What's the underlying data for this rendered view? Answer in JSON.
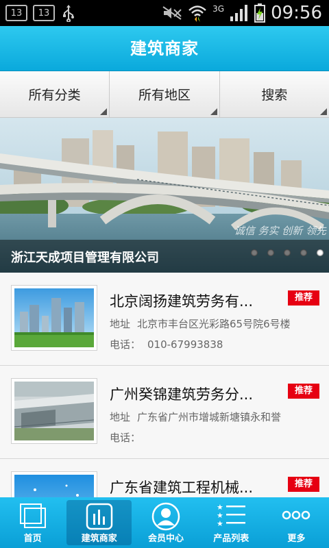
{
  "status_bar": {
    "left_badges": [
      "13",
      "13"
    ],
    "network": "3G",
    "time": "09:56"
  },
  "header": {
    "title": "建筑商家"
  },
  "filters": [
    {
      "label": "所有分类"
    },
    {
      "label": "所有地区"
    },
    {
      "label": "搜索"
    }
  ],
  "banner": {
    "caption": "浙江天成项目管理有限公司",
    "slogan": "诚信 务实 创新 领先",
    "slides": 5,
    "active_slide": 5
  },
  "businesses": [
    {
      "name": "北京阔扬建筑劳务有...",
      "badge": "推荐",
      "address_label": "地址",
      "address": "北京市丰台区光彩路65号院6号楼",
      "phone_label": "电话：",
      "phone": "010-67993838"
    },
    {
      "name": "广州癸锦建筑劳务分...",
      "badge": "推荐",
      "address_label": "地址",
      "address": "广东省广州市增城新塘镇永和誉",
      "phone_label": "电话：",
      "phone": ""
    },
    {
      "name": "广东省建筑工程机械...",
      "badge": "推荐",
      "address_label": "",
      "address": "",
      "phone_label": "",
      "phone": ""
    }
  ],
  "bottom_nav": [
    {
      "label": "首页",
      "icon": "home-icon"
    },
    {
      "label": "建筑商家",
      "icon": "chart-icon",
      "active": true
    },
    {
      "label": "会员中心",
      "icon": "user-icon"
    },
    {
      "label": "产品列表",
      "icon": "list-icon"
    },
    {
      "label": "更多",
      "icon": "more-icon"
    }
  ],
  "colors": {
    "accent": "#0aa9dc",
    "badge": "#e60012"
  }
}
